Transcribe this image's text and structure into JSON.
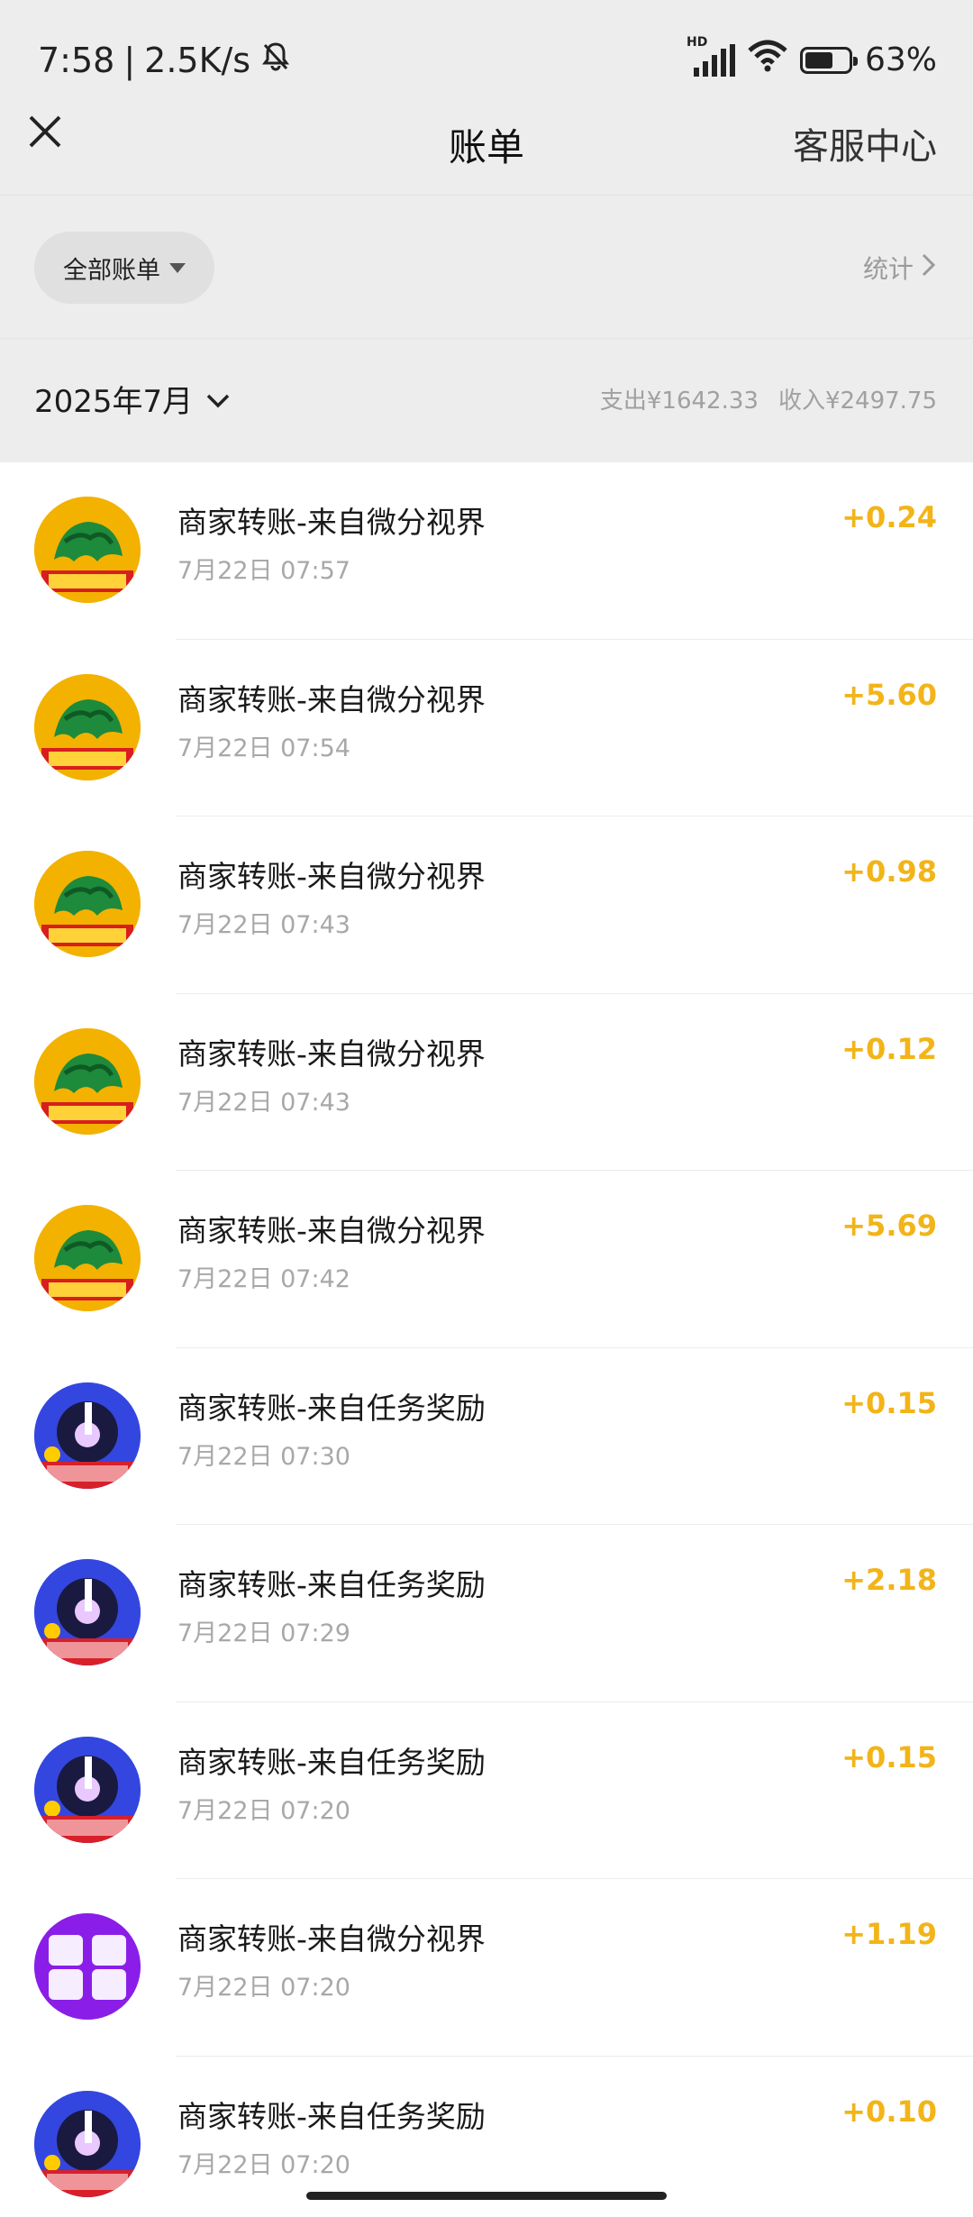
{
  "status_bar": {
    "time": "7:58",
    "net_speed": "2.5K/s",
    "hd_label": "HD",
    "battery_percent": "63%",
    "icons": [
      "mute-bell-icon",
      "signal-icon",
      "wifi-icon",
      "battery-icon"
    ]
  },
  "nav": {
    "title": "账单",
    "right_label": "客服中心",
    "close_icon": "close-icon"
  },
  "filter": {
    "label": "全部账单",
    "stats_label": "统计"
  },
  "month": {
    "label": "2025年7月",
    "expense": "支出¥1642.33",
    "income": "收入¥2497.75"
  },
  "transactions": [
    {
      "title": "商家转账-来自微分视界",
      "time": "7月22日 07:57",
      "amount": "+0.24",
      "avatar": "dragon"
    },
    {
      "title": "商家转账-来自微分视界",
      "time": "7月22日 07:54",
      "amount": "+5.60",
      "avatar": "dragon"
    },
    {
      "title": "商家转账-来自微分视界",
      "time": "7月22日 07:43",
      "amount": "+0.98",
      "avatar": "dragon"
    },
    {
      "title": "商家转账-来自微分视界",
      "time": "7月22日 07:43",
      "amount": "+0.12",
      "avatar": "dragon"
    },
    {
      "title": "商家转账-来自微分视界",
      "time": "7月22日 07:42",
      "amount": "+5.69",
      "avatar": "dragon"
    },
    {
      "title": "商家转账-来自任务奖励",
      "time": "7月22日 07:30",
      "amount": "+0.15",
      "avatar": "music"
    },
    {
      "title": "商家转账-来自任务奖励",
      "time": "7月22日 07:29",
      "amount": "+2.18",
      "avatar": "music"
    },
    {
      "title": "商家转账-来自任务奖励",
      "time": "7月22日 07:20",
      "amount": "+0.15",
      "avatar": "music"
    },
    {
      "title": "商家转账-来自微分视界",
      "time": "7月22日 07:20",
      "amount": "+1.19",
      "avatar": "box"
    },
    {
      "title": "商家转账-来自任务奖励",
      "time": "7月22日 07:20",
      "amount": "+0.10",
      "avatar": "music"
    }
  ],
  "colors": {
    "income_amount": "#f2b418",
    "background": "#ededed"
  }
}
